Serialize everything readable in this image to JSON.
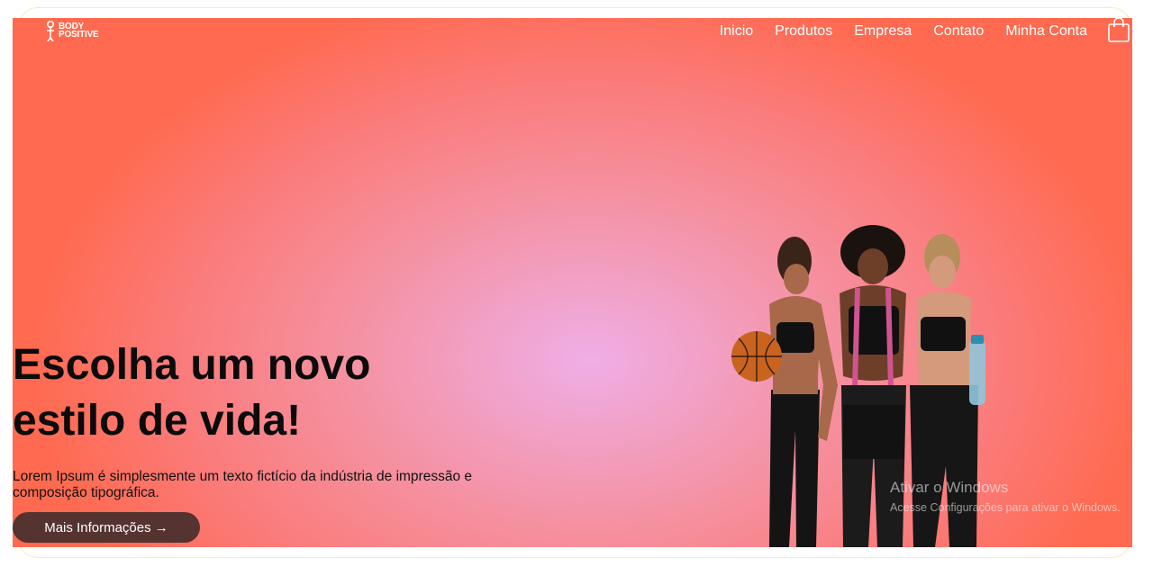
{
  "brand": {
    "logo_line1": "BODY",
    "logo_line2": "POSITIVE"
  },
  "nav": {
    "items": [
      "Inicio",
      "Produtos",
      "Empresa",
      "Contato",
      "Minha Conta"
    ]
  },
  "hero": {
    "title": "Escolha um novo\nestilo de vida!",
    "description": "Lorem Ipsum é simplesmente um texto fictício da indústria de impressão e composição tipográfica.",
    "button_label": "Mais Informações →"
  },
  "watermark": {
    "line1": "Ativar o Windows",
    "line2": "Acesse Configurações para ativar o Windows."
  },
  "icons": {
    "cart": "shopping-bag-icon",
    "logo": "logo-figure-icon"
  },
  "colors": {
    "button": "#553330",
    "gradient_center": "#efaee6",
    "gradient_edge": "#ff6a50"
  }
}
